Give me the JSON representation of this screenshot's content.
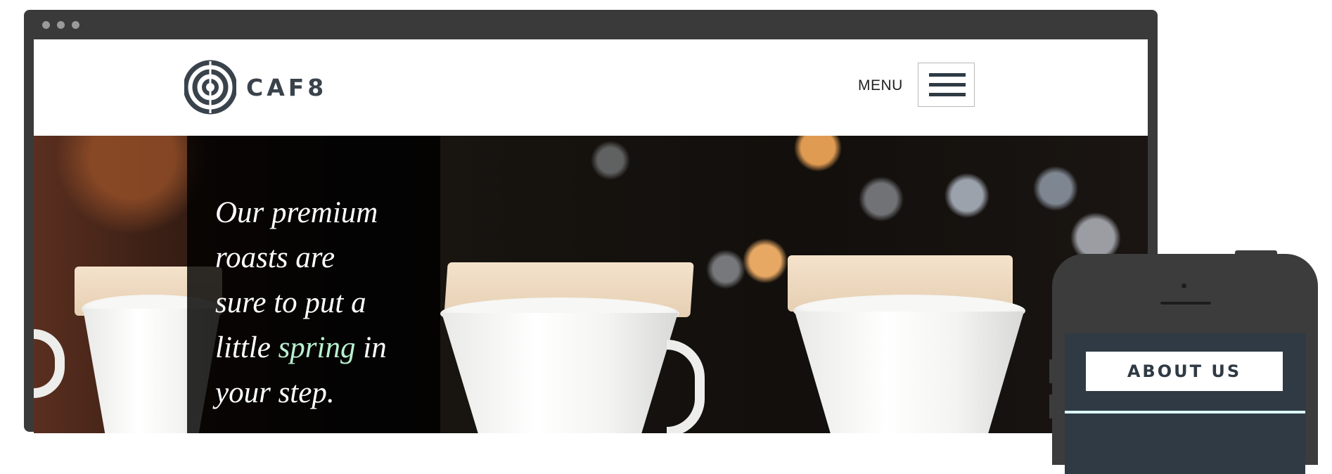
{
  "brand": {
    "name": "CAF8"
  },
  "nav": {
    "menu_label": "MENU"
  },
  "hero": {
    "line_1": "Our premium",
    "line_2": "roasts are",
    "line_3": "sure to put a",
    "line_4_before": "little ",
    "line_4_accent": "spring",
    "line_4_after": " in",
    "line_5": "your step.",
    "accent_color": "#b9f0cf"
  },
  "mobile": {
    "about_label": "ABOUT US"
  },
  "colors": {
    "brand_dark": "#2f3a44",
    "frame": "#3a3a3a"
  },
  "icons": [
    "window-dot-icon",
    "caf8-logo-icon",
    "hamburger-icon",
    "camera-icon",
    "speaker-icon"
  ]
}
